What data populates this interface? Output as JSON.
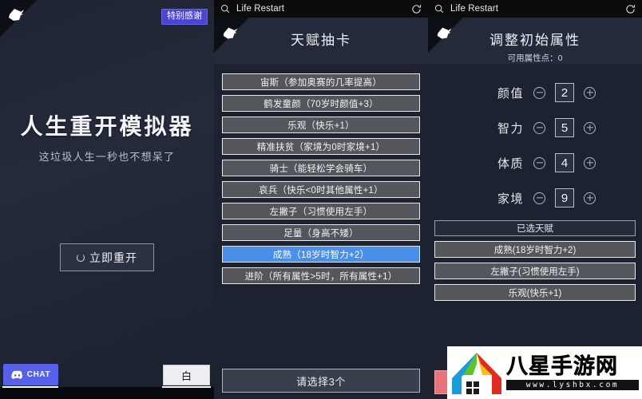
{
  "window": {
    "left_panel": {
      "thanks_badge": "特别感谢",
      "title": "人生重开模拟器",
      "subtitle": "这垃圾人生一秒也不想呆了",
      "restart_button": "立即重开",
      "discord_label": "CHAT",
      "white_button": "白",
      "corner_icon": "bird-logo-icon",
      "spinner_icon": "loading-ring-icon",
      "discord_icon": "discord-icon"
    },
    "mid_panel": {
      "chrome": {
        "search_icon": "search-icon",
        "title": "Life Restart",
        "refresh_icon": "refresh-icon"
      },
      "header_title": "天赋抽卡",
      "corner_icon": "bird-logo-icon",
      "talents": [
        {
          "label": "宙斯（参加奥赛的几率提高）",
          "selected": false
        },
        {
          "label": "鹤发童颜（70岁时颜值+3）",
          "selected": false
        },
        {
          "label": "乐观（快乐+1）",
          "selected": false
        },
        {
          "label": "精准扶贫（家境为0时家境+1）",
          "selected": false
        },
        {
          "label": "骑士（能轻松学会骑车）",
          "selected": false
        },
        {
          "label": "哀兵（快乐<0时其他属性+1）",
          "selected": false
        },
        {
          "label": "左撇子（习惯使用左手）",
          "selected": false
        },
        {
          "label": "足量（身高不矮）",
          "selected": false
        },
        {
          "label": "成熟（18岁时智力+2）",
          "selected": true
        },
        {
          "label": "进阶（所有属性>5时，所有属性+1）",
          "selected": false
        }
      ],
      "confirm_label": "请选择3个"
    },
    "right_panel": {
      "chrome": {
        "search_icon": "search-icon",
        "title": "Life Restart",
        "refresh_icon": "refresh-icon"
      },
      "header_title": "调整初始属性",
      "header_subtitle": "可用属性点：0",
      "corner_icon": "bird-logo-icon",
      "attributes": [
        {
          "name": "颜值",
          "value": "2",
          "minus_icon": "minus-circle-icon",
          "plus_icon": "plus-circle-icon"
        },
        {
          "name": "智力",
          "value": "5",
          "minus_icon": "minus-circle-icon",
          "plus_icon": "plus-circle-icon"
        },
        {
          "name": "体质",
          "value": "4",
          "minus_icon": "minus-circle-icon",
          "plus_icon": "plus-circle-icon"
        },
        {
          "name": "家境",
          "value": "9",
          "minus_icon": "minus-circle-icon",
          "plus_icon": "plus-circle-icon"
        }
      ],
      "chosen_header": "已选天赋",
      "chosen_talents": [
        "成熟(18岁时智力+2)",
        "左撇子(习惯使用左手)",
        "乐观(快乐+1)"
      ],
      "action_button": ""
    },
    "watermark": {
      "name": "八星手游网",
      "url": "www.lyshbx.com",
      "logo_icon": "windows-house-logo-icon"
    }
  },
  "colors": {
    "accent_blue": "#4a8fe8",
    "panel_bg": "#1d2230",
    "header_bg": "#242a3a",
    "card_bg": "#54565c",
    "badge_purple": "#4b45d6",
    "discord_blurple": "#5660e8",
    "red_button": "#e8737d"
  }
}
